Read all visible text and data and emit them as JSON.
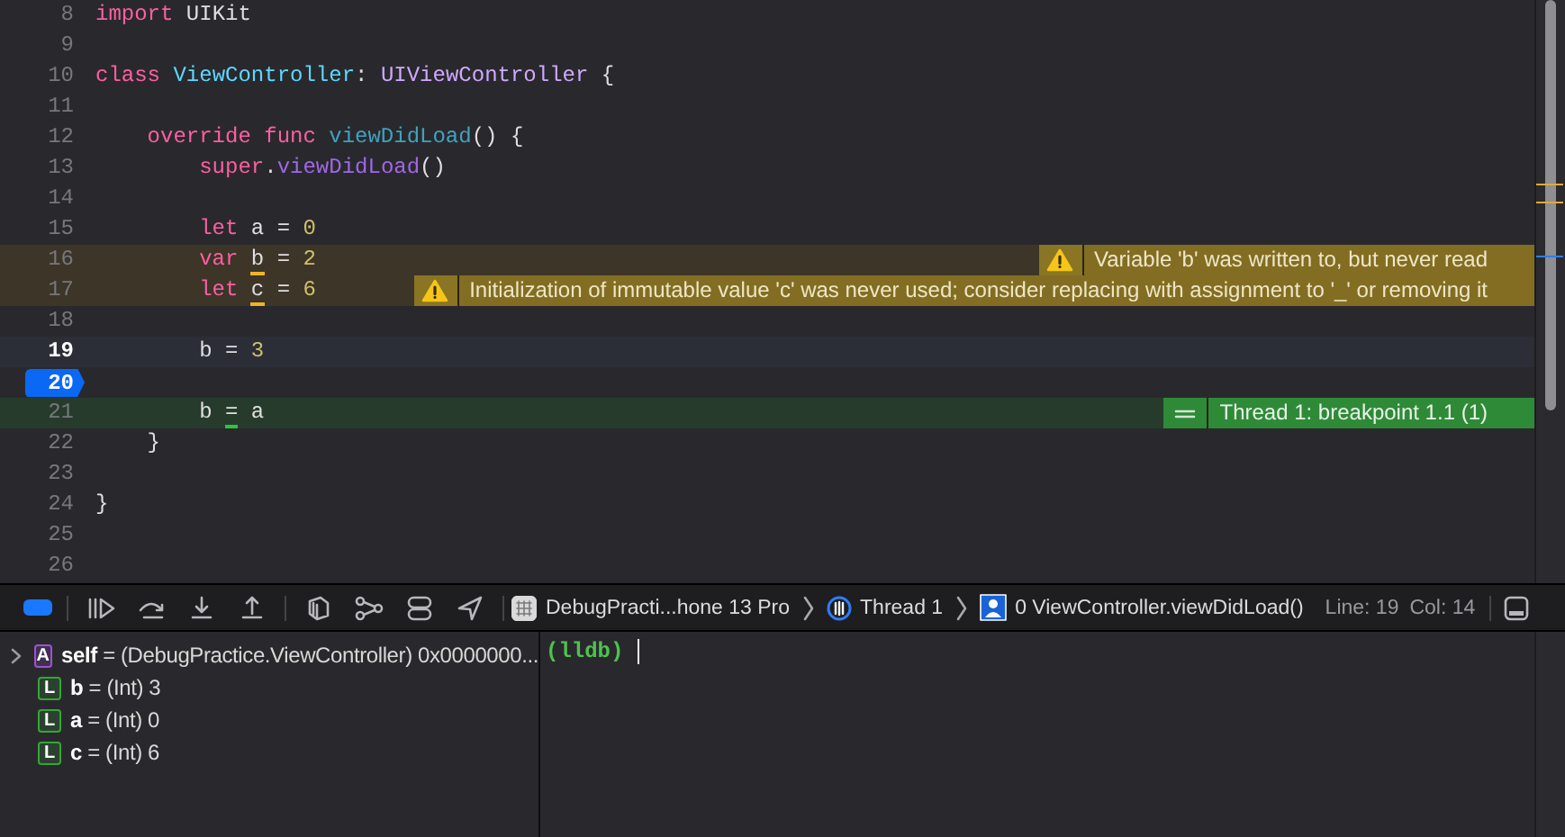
{
  "editor": {
    "lines": [
      {
        "number": "8",
        "kind": "plain",
        "breakpoint": false,
        "tokens": [
          {
            "text": "import",
            "kind": "keyword"
          },
          {
            "text": " UIKit",
            "kind": "plain"
          }
        ]
      },
      {
        "number": "9",
        "kind": "plain",
        "breakpoint": false
      },
      {
        "number": "10",
        "kind": "plain",
        "breakpoint": false,
        "tokens": [
          {
            "text": "class ",
            "kind": "keyword"
          },
          {
            "text": "ViewController",
            "kind": "type-decl"
          },
          {
            "text": ": ",
            "kind": "plain"
          },
          {
            "text": "UIViewController",
            "kind": "type"
          },
          {
            "text": " {",
            "kind": "plain"
          }
        ]
      },
      {
        "number": "11",
        "kind": "plain",
        "breakpoint": false
      },
      {
        "number": "12",
        "kind": "plain",
        "breakpoint": false,
        "tokens": [
          {
            "text": "    override func ",
            "kind": "keyword"
          },
          {
            "text": "viewDidLoad",
            "kind": "func-decl"
          },
          {
            "text": "() {",
            "kind": "plain"
          }
        ]
      },
      {
        "number": "13",
        "kind": "plain",
        "breakpoint": false,
        "tokens": [
          {
            "text": "        super",
            "kind": "keyword"
          },
          {
            "text": ".",
            "kind": "plain"
          },
          {
            "text": "viewDidLoad",
            "kind": "method"
          },
          {
            "text": "()",
            "kind": "plain"
          }
        ]
      },
      {
        "number": "14",
        "kind": "plain",
        "breakpoint": false
      },
      {
        "number": "15",
        "kind": "plain",
        "breakpoint": false,
        "tokens": [
          {
            "text": "        let",
            "kind": "keyword"
          },
          {
            "text": " a = ",
            "kind": "plain"
          },
          {
            "text": "0",
            "kind": "number"
          }
        ]
      },
      {
        "number": "16",
        "kind": "warning",
        "breakpoint": false,
        "tokens": [
          {
            "text": "        var ",
            "kind": "keyword"
          },
          {
            "text": "b",
            "kind": "plain",
            "underlined": true
          },
          {
            "text": " = ",
            "kind": "plain"
          },
          {
            "text": "2",
            "kind": "number"
          }
        ],
        "annotation": {
          "kind": "warning",
          "text": "Variable 'b' was written to, but never read"
        }
      },
      {
        "number": "17",
        "kind": "warning",
        "breakpoint": false,
        "tokens": [
          {
            "text": "        let ",
            "kind": "keyword"
          },
          {
            "text": "c",
            "kind": "plain",
            "underlined": true
          },
          {
            "text": " = ",
            "kind": "plain"
          },
          {
            "text": "6",
            "kind": "number"
          }
        ],
        "annotation": {
          "kind": "warning",
          "text": "Initialization of immutable value 'c' was never used; consider replacing with assignment to '_' or removing it"
        }
      },
      {
        "number": "18",
        "kind": "plain",
        "breakpoint": false
      },
      {
        "number": "19",
        "kind": "current",
        "breakpoint": false,
        "tokens": [
          {
            "text": "        b = ",
            "kind": "plain"
          },
          {
            "text": "3",
            "kind": "number"
          }
        ]
      },
      {
        "number": "20",
        "kind": "plain",
        "breakpoint": true
      },
      {
        "number": "21",
        "kind": "stopped",
        "breakpoint": false,
        "tokens": [
          {
            "text": "        b ",
            "kind": "plain"
          },
          {
            "text": "=",
            "kind": "plain",
            "underlined": true
          },
          {
            "text": " a",
            "kind": "plain"
          }
        ],
        "annotation": {
          "kind": "stopped",
          "text": "Thread 1: breakpoint 1.1 (1)"
        }
      },
      {
        "number": "22",
        "kind": "plain",
        "breakpoint": false,
        "tokens": [
          {
            "text": "    }",
            "kind": "plain"
          }
        ]
      },
      {
        "number": "23",
        "kind": "plain",
        "breakpoint": false
      },
      {
        "number": "24",
        "kind": "plain",
        "breakpoint": false,
        "tokens": [
          {
            "text": "}",
            "kind": "plain"
          }
        ]
      },
      {
        "number": "25",
        "kind": "plain",
        "breakpoint": false
      },
      {
        "number": "26",
        "kind": "plain",
        "breakpoint": false
      }
    ]
  },
  "debug_bar": {
    "breakpoints_active": true,
    "scheme": "DebugPracti...hone 13 Pro",
    "thread": "Thread 1",
    "frame": "0 ViewController.viewDidLoad()",
    "line": "Line: 19",
    "column": "Col: 14"
  },
  "variables": [
    {
      "badge": "A",
      "color": "#a24fd6",
      "expandable": true,
      "text": "**self** = (DebugPractice.ViewController) 0x0000000..."
    },
    {
      "badge": "L",
      "color": "#36a537",
      "expandable": false,
      "text": "**b** = (Int) 3"
    },
    {
      "badge": "L",
      "color": "#36a537",
      "expandable": false,
      "text": "**a** = (Int) 0"
    },
    {
      "badge": "L",
      "color": "#36a537",
      "expandable": false,
      "text": "**c** = (Int) 6"
    }
  ],
  "console": {
    "prompt": "(lldb)"
  }
}
